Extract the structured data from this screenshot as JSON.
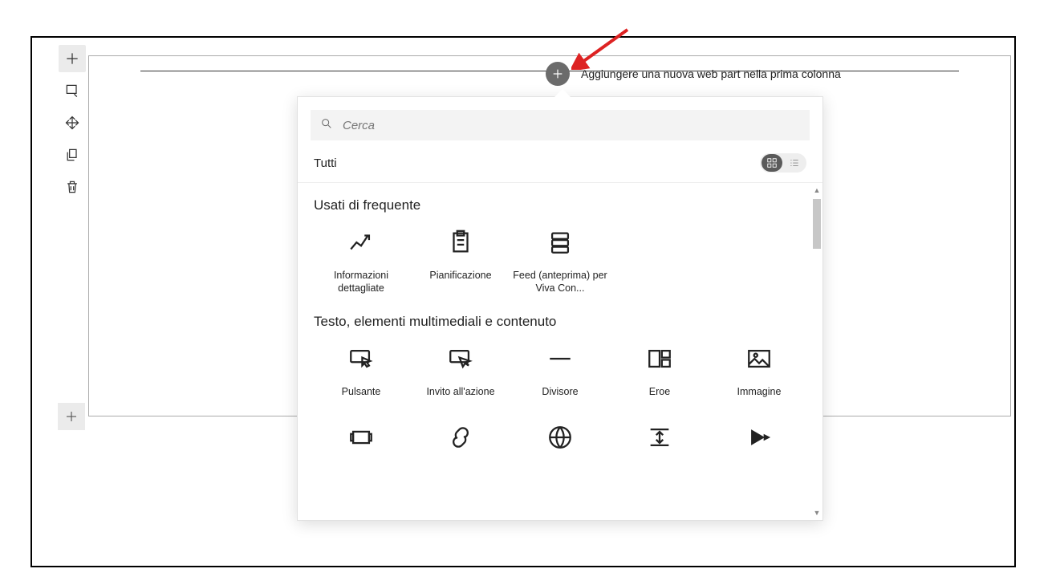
{
  "hover_tip": "Aggiungere una nuova web part nella prima colonna",
  "search": {
    "placeholder": "Cerca"
  },
  "filter_label": "Tutti",
  "sections": {
    "frequent": {
      "title": "Usati di frequente",
      "items": [
        {
          "label": "Informazioni dettagliate"
        },
        {
          "label": "Pianificazione"
        },
        {
          "label": "Feed (anteprima) per Viva Con..."
        }
      ]
    },
    "content": {
      "title": "Testo, elementi multimediali e contenuto",
      "items": [
        {
          "label": "Pulsante"
        },
        {
          "label": "Invito all'azione"
        },
        {
          "label": "Divisore"
        },
        {
          "label": "Eroe"
        },
        {
          "label": "Immagine"
        }
      ]
    }
  }
}
